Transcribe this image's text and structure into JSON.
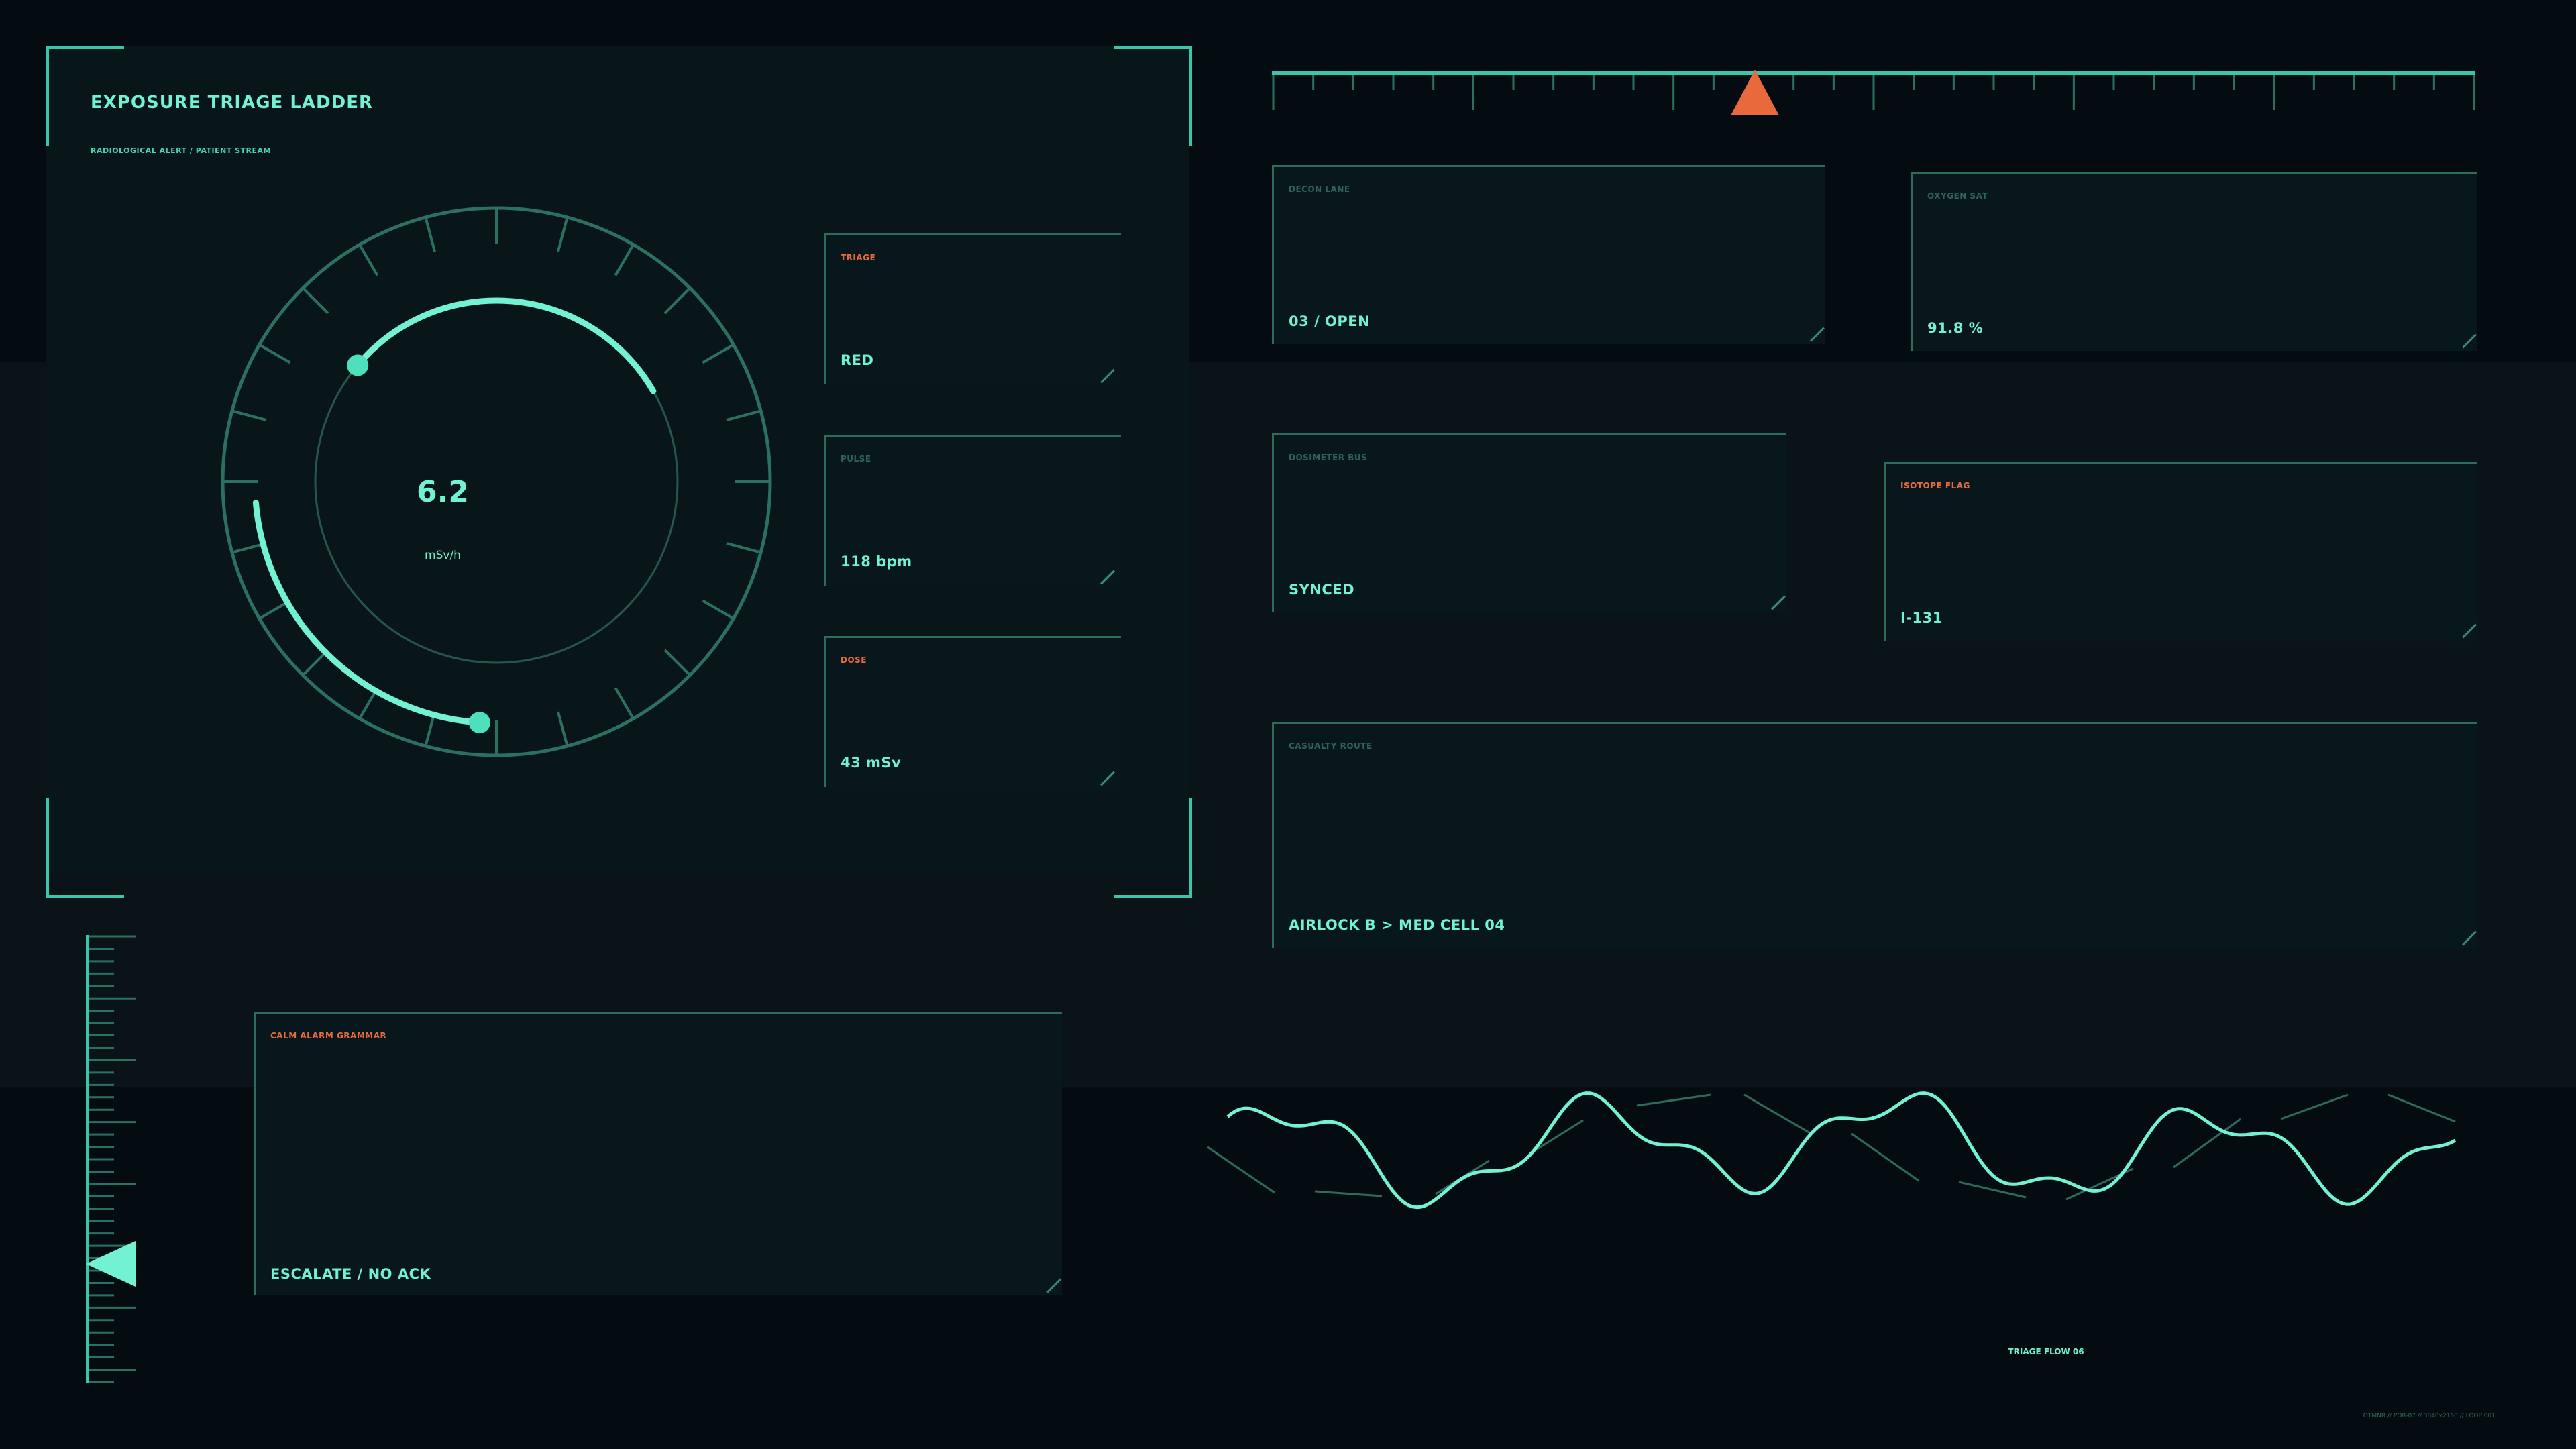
{
  "header": {
    "title": "EXPOSURE TRIAGE LADDER",
    "subtitle": "RADIOLOGICAL ALERT / PATIENT STREAM"
  },
  "gauge": {
    "value": "6.2",
    "unit": "mSv/h"
  },
  "side_cards": [
    {
      "label": "TRIAGE",
      "value": "RED",
      "alert": true
    },
    {
      "label": "PULSE",
      "value": "118 bpm",
      "alert": false
    },
    {
      "label": "DOSE",
      "value": "43 mSv",
      "alert": true
    }
  ],
  "status_cards": {
    "decon_lane": {
      "label": "DECON LANE",
      "value": "03 / OPEN"
    },
    "oxygen_sat": {
      "label": "OXYGEN SAT",
      "value": "91.8 %"
    },
    "dosimeter_bus": {
      "label": "DOSIMETER BUS",
      "value": "SYNCED"
    },
    "isotope_flag": {
      "label": "ISOTOPE FLAG",
      "value": "I-131"
    },
    "casualty_route": {
      "label": "CASUALTY ROUTE",
      "value": "AIRLOCK B > MED CELL 04"
    },
    "calm_alarm": {
      "label": "CALM ALARM GRAMMAR",
      "value": "ESCALATE / NO ACK"
    }
  },
  "waveform": {
    "label": "TRIAGE FLOW 06"
  },
  "footer": {
    "meta": "OTMNR // POR-07 // 3840x2160 // LOOP 001"
  },
  "colors": {
    "background": "#050c11",
    "panel": "#081519",
    "accent": "#72f2d2",
    "frame": "#39c6ab",
    "muted": "#2d6b5f",
    "alert": "#e86a3c"
  }
}
